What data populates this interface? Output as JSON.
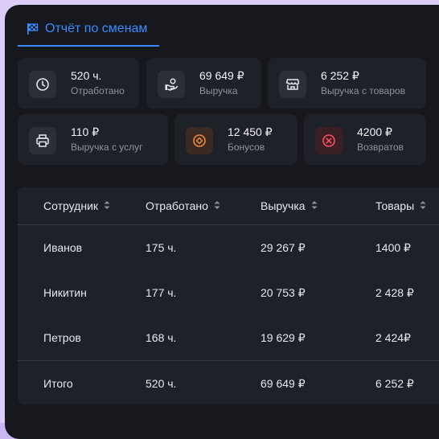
{
  "tab": {
    "label": "Отчёт по сменам",
    "icon": "checkered-flag-icon"
  },
  "stats": [
    {
      "value": "520 ч.",
      "label": "Отработано",
      "icon": "clock-icon"
    },
    {
      "value": "69 649 ₽",
      "label": "Выручка",
      "icon": "money-hand-icon"
    },
    {
      "value": "6 252 ₽",
      "label": "Выручка с товаров",
      "icon": "store-icon"
    },
    {
      "value": "110 ₽",
      "label": "Выручка с услуг",
      "icon": "printer-icon"
    },
    {
      "value": "12 450 ₽",
      "label": "Бонусов",
      "icon": "bonus-icon"
    },
    {
      "value": "4200 ₽",
      "label": "Возвратов",
      "icon": "cancel-icon"
    }
  ],
  "table": {
    "columns": [
      "Сотрудник",
      "Отработано",
      "Выручка",
      "Товары"
    ],
    "rows": [
      [
        "Иванов",
        "175 ч.",
        "29 267 ₽",
        "1400 ₽"
      ],
      [
        "Никитин",
        "177 ч.",
        "20 753 ₽",
        "2 428 ₽"
      ],
      [
        "Петров",
        "168 ч.",
        "19 629 ₽",
        "2 424₽"
      ]
    ],
    "total": [
      "Итого",
      "520 ч.",
      "69 649 ₽",
      "6 252 ₽"
    ]
  },
  "colors": {
    "accent": "#3b8cff",
    "panel": "#16181d",
    "card": "#1e2128",
    "bonus": "#f08a3c",
    "returns": "#ff4d5e"
  }
}
